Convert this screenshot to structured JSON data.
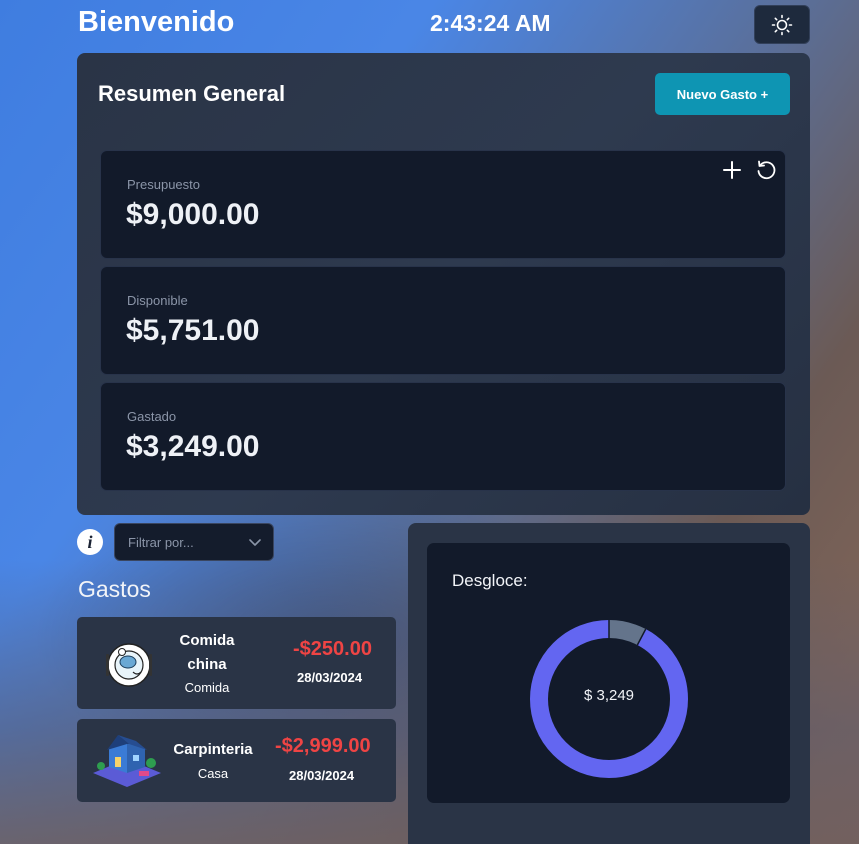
{
  "header": {
    "title": "Bienvenido",
    "clock": "2:43:24 AM",
    "theme_icon": "sun-icon"
  },
  "summary": {
    "title": "Resumen General",
    "new_button": "Nuevo Gasto +",
    "stats": [
      {
        "label": "Presupuesto",
        "value": "$9,000.00"
      },
      {
        "label": "Disponible",
        "value": "$5,751.00"
      },
      {
        "label": "Gastado",
        "value": "$3,249.00"
      }
    ]
  },
  "filter": {
    "placeholder": "Filtrar por...",
    "info_icon": "i"
  },
  "expenses": {
    "title": "Gastos",
    "items": [
      {
        "name_line1": "Comida",
        "name_line2": "china",
        "category": "Comida",
        "amount": "-$250.00",
        "date": "28/03/2024"
      },
      {
        "name_line1": "Carpinteria",
        "category": "Casa",
        "amount": "-$2,999.00",
        "date": "28/03/2024"
      }
    ]
  },
  "breakdown": {
    "title": "Desgloce:",
    "center_label": "$ 3,249"
  },
  "colors": {
    "accent": "#0e95b3",
    "negative": "#ef4444",
    "donut_main": "#6366f1",
    "donut_secondary": "#64748b"
  },
  "chart_data": {
    "type": "pie",
    "categories": [
      "Casa",
      "Comida"
    ],
    "values": [
      2999,
      250
    ]
  }
}
